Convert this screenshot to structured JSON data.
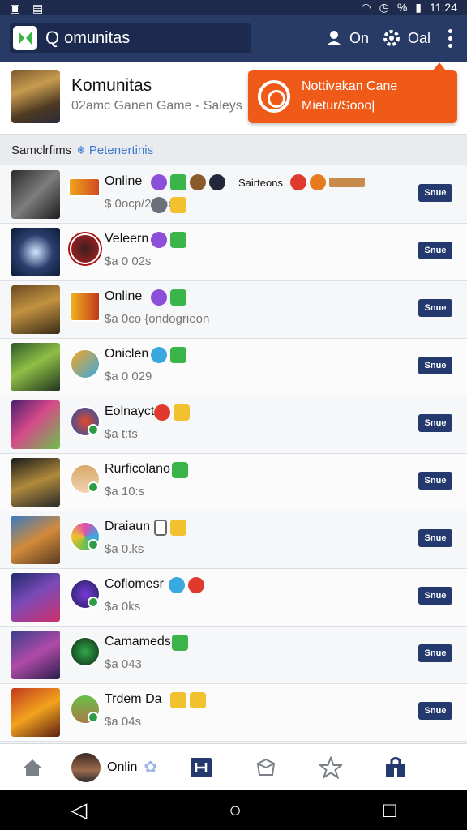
{
  "status_bar": {
    "battery_label": "%",
    "time": "11:24"
  },
  "appbar": {
    "search_text": "omunitas",
    "action_one_label": "On",
    "action_two_label": "Oal"
  },
  "header": {
    "title": "Komunitas",
    "subtitle": "02amc Ganen Game - Saleys",
    "notification": {
      "line1": "Nottivakan Cane",
      "line2": "Mietur/Sooo|"
    }
  },
  "section": {
    "label": "Samclrfims",
    "link": "Petenertinis"
  },
  "rows": [
    {
      "name": "Online",
      "meta": "$ 0ocp/2 0nc -",
      "extra": "Sairteons",
      "button": "Snue"
    },
    {
      "name": "Veleern",
      "meta": "$a 0 02s",
      "button": "Snue"
    },
    {
      "name": "Online",
      "meta": "$a 0co  {ondogrieon",
      "button": "Snue"
    },
    {
      "name": "Oniclen",
      "meta": "$a 0 029",
      "button": "Snue"
    },
    {
      "name": "Eolnayct",
      "meta": "$a t:ts",
      "button": "Snue"
    },
    {
      "name": "Rurficolano",
      "meta": "$a 10:s",
      "button": "Snue"
    },
    {
      "name": "Draiaun",
      "meta": "$a 0.ks",
      "button": "Snue"
    },
    {
      "name": "Cofiomesr",
      "meta": "$a 0ks",
      "button": "Snue"
    },
    {
      "name": "Camameds",
      "meta": "$a 043",
      "button": "Snue"
    },
    {
      "name": "Trdem Da",
      "meta": "$a 04s",
      "button": "Snue"
    }
  ],
  "bottom_nav": {
    "online_label": "Onlin"
  },
  "icons": {
    "home": "home-icon",
    "tournament": "bracket-icon",
    "store": "box-icon",
    "favorites": "star-icon",
    "shop": "shop-icon"
  }
}
